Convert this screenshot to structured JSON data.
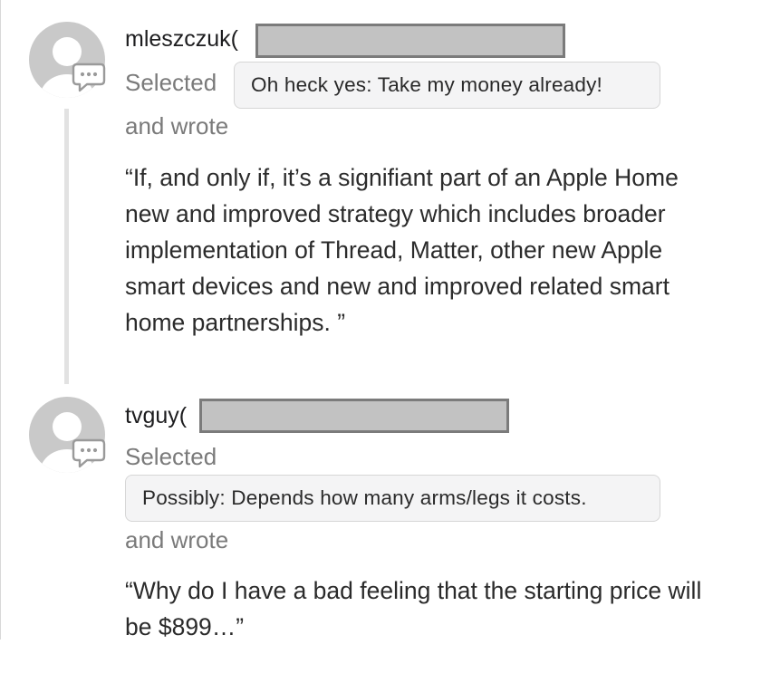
{
  "responses": [
    {
      "username": "mleszczuk(",
      "selected_label": "Selected",
      "choice": "Oh heck yes: Take my money already!",
      "wrote_label": "and wrote",
      "quote": "“If, and only if, it’s a signifiant part of an Apple Home new and improved strategy which includes broader implementation of Thread, Matter, other new Apple smart devices and new and improved related smart home partnerships. ”"
    },
    {
      "username": "tvguy(",
      "selected_label": "Selected",
      "choice": "Possibly: Depends how many arms/legs it costs.",
      "wrote_label": "and wrote",
      "quote": "“Why do I have a bad feeling that the starting price will be $899…”"
    }
  ],
  "icons": {
    "avatar": "default-user-avatar-icon",
    "comment": "comment-bubble-icon"
  },
  "colors": {
    "avatar_gray": "#c9c9c9",
    "muted_text": "#7a7a7a",
    "pill_background": "#f4f4f5",
    "redaction_fill": "#c2c2c2",
    "redaction_border": "#7b7b7b"
  }
}
